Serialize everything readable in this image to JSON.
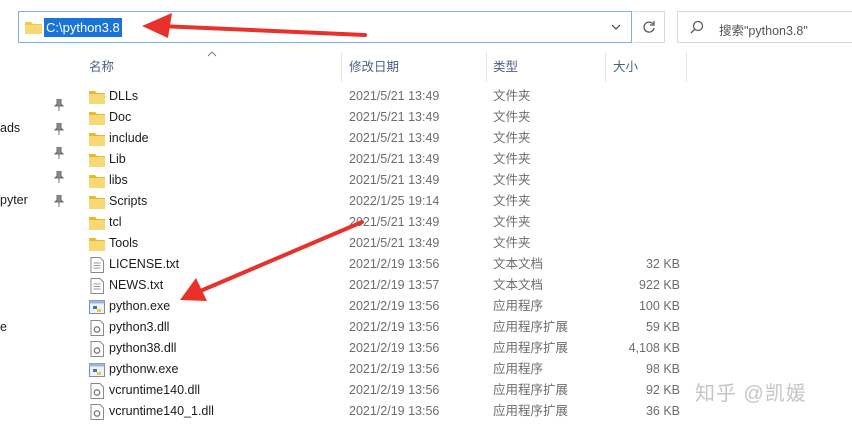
{
  "address": {
    "path": "C:\\python3.8"
  },
  "search": {
    "placeholder": "搜索\"python3.8\""
  },
  "nav": {
    "fragments": [
      "ads",
      "pyter",
      "e"
    ]
  },
  "columns": {
    "name": "名称",
    "date": "修改日期",
    "type": "类型",
    "size": "大小"
  },
  "files": [
    {
      "name": "DLLs",
      "date": "2021/5/21 13:49",
      "type": "文件夹",
      "size": "",
      "icon": "folder-icon"
    },
    {
      "name": "Doc",
      "date": "2021/5/21 13:49",
      "type": "文件夹",
      "size": "",
      "icon": "folder-icon"
    },
    {
      "name": "include",
      "date": "2021/5/21 13:49",
      "type": "文件夹",
      "size": "",
      "icon": "folder-icon"
    },
    {
      "name": "Lib",
      "date": "2021/5/21 13:49",
      "type": "文件夹",
      "size": "",
      "icon": "folder-icon"
    },
    {
      "name": "libs",
      "date": "2021/5/21 13:49",
      "type": "文件夹",
      "size": "",
      "icon": "folder-icon"
    },
    {
      "name": "Scripts",
      "date": "2022/1/25 19:14",
      "type": "文件夹",
      "size": "",
      "icon": "folder-icon"
    },
    {
      "name": "tcl",
      "date": "2021/5/21 13:49",
      "type": "文件夹",
      "size": "",
      "icon": "folder-icon"
    },
    {
      "name": "Tools",
      "date": "2021/5/21 13:49",
      "type": "文件夹",
      "size": "",
      "icon": "folder-icon"
    },
    {
      "name": "LICENSE.txt",
      "date": "2021/2/19 13:56",
      "type": "文本文档",
      "size": "32 KB",
      "icon": "text-file-icon"
    },
    {
      "name": "NEWS.txt",
      "date": "2021/2/19 13:57",
      "type": "文本文档",
      "size": "922 KB",
      "icon": "text-file-icon"
    },
    {
      "name": "python.exe",
      "date": "2021/2/19 13:56",
      "type": "应用程序",
      "size": "100 KB",
      "icon": "python-exe-icon"
    },
    {
      "name": "python3.dll",
      "date": "2021/2/19 13:56",
      "type": "应用程序扩展",
      "size": "59 KB",
      "icon": "dll-file-icon"
    },
    {
      "name": "python38.dll",
      "date": "2021/2/19 13:56",
      "type": "应用程序扩展",
      "size": "4,108 KB",
      "icon": "dll-file-icon"
    },
    {
      "name": "pythonw.exe",
      "date": "2021/2/19 13:56",
      "type": "应用程序",
      "size": "98 KB",
      "icon": "python-exe-icon"
    },
    {
      "name": "vcruntime140.dll",
      "date": "2021/2/19 13:56",
      "type": "应用程序扩展",
      "size": "92 KB",
      "icon": "dll-file-icon"
    },
    {
      "name": "vcruntime140_1.dll",
      "date": "2021/2/19 13:56",
      "type": "应用程序扩展",
      "size": "36 KB",
      "icon": "dll-file-icon"
    }
  ],
  "watermark": "知乎 @凯媛",
  "colors": {
    "selection": "#1a73d6",
    "annotation_arrow": "#e8312a",
    "folder": "#f5c842"
  }
}
